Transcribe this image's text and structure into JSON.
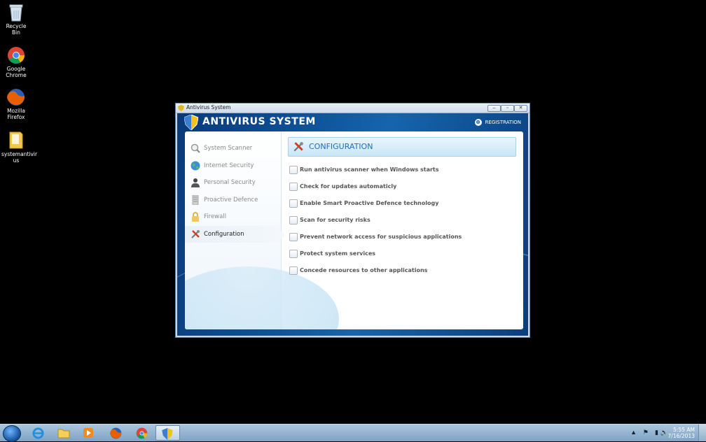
{
  "desktop": {
    "icons": [
      {
        "label": "Recycle Bin",
        "icon": "recycle-bin-icon"
      },
      {
        "label": "Google Chrome",
        "icon": "chrome-icon"
      },
      {
        "label": "Mozilla Firefox",
        "icon": "firefox-icon"
      },
      {
        "label": "systemantivirus",
        "icon": "folder-icon"
      }
    ]
  },
  "window": {
    "title": "Antivirus System",
    "app_name": "ANTIVIRUS SYSTEM",
    "registration": "REGISTRATION",
    "nav": [
      {
        "label": "System Scanner",
        "icon": "magnifier-icon",
        "active": false
      },
      {
        "label": "Internet Security",
        "icon": "globe-icon",
        "active": false
      },
      {
        "label": "Personal Security",
        "icon": "person-icon",
        "active": false
      },
      {
        "label": "Proactive Defence",
        "icon": "server-icon",
        "active": false
      },
      {
        "label": "Firewall",
        "icon": "lock-icon",
        "active": false
      },
      {
        "label": "Configuration",
        "icon": "tools-icon",
        "active": true
      }
    ],
    "section_title": "CONFIGURATION",
    "options": [
      {
        "label": "Run antivirus scanner when Windows starts",
        "checked": false
      },
      {
        "label": "Check for updates automaticly",
        "checked": false
      },
      {
        "label": "Enable Smart Proactive Defence technology",
        "checked": false
      },
      {
        "label": "Scan for security risks",
        "checked": false
      },
      {
        "label": "Prevent network access for suspicious applications",
        "checked": false
      },
      {
        "label": "Protect system services",
        "checked": false
      },
      {
        "label": "Concede resources to other applications",
        "checked": false
      }
    ]
  },
  "taskbar": {
    "pinned": [
      {
        "icon": "internet-explorer-icon"
      },
      {
        "icon": "file-explorer-icon"
      },
      {
        "icon": "media-player-icon"
      },
      {
        "icon": "firefox-icon"
      },
      {
        "icon": "chrome-icon"
      },
      {
        "icon": "antivirus-shield-icon",
        "active": true
      }
    ],
    "clock_time": "5:55 AM",
    "clock_date": "7/16/2013"
  }
}
